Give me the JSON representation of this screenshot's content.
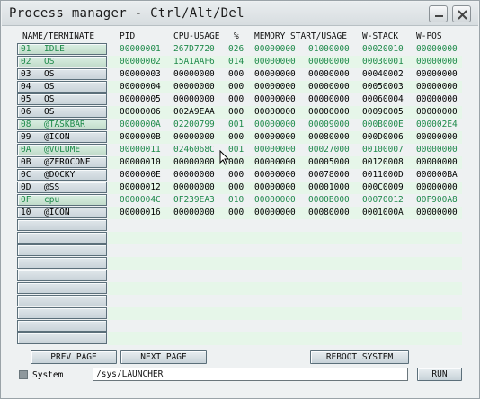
{
  "window": {
    "title": "Process manager - Ctrl/Alt/Del"
  },
  "columns": {
    "name": "NAME/TERMINATE",
    "pid": "PID",
    "cpu": "CPU-USAGE",
    "pct": "%",
    "mem": "MEMORY START/USAGE",
    "wstack": "W-STACK",
    "wpos": "W-POS"
  },
  "processes": [
    {
      "idx": "01",
      "name": "IDLE",
      "pid": "00000001",
      "cpu": "267D7720",
      "pct": "026",
      "mem_start": "00000000",
      "mem_usage": "01000000",
      "wstack": "00020010",
      "wpos": "00000000",
      "highlight": true
    },
    {
      "idx": "02",
      "name": "OS",
      "pid": "00000002",
      "cpu": "15A1AAF6",
      "pct": "014",
      "mem_start": "00000000",
      "mem_usage": "00000000",
      "wstack": "00030001",
      "wpos": "00000000",
      "highlight": true
    },
    {
      "idx": "03",
      "name": "OS",
      "pid": "00000003",
      "cpu": "00000000",
      "pct": "000",
      "mem_start": "00000000",
      "mem_usage": "00000000",
      "wstack": "00040002",
      "wpos": "00000000",
      "highlight": false
    },
    {
      "idx": "04",
      "name": "OS",
      "pid": "00000004",
      "cpu": "00000000",
      "pct": "000",
      "mem_start": "00000000",
      "mem_usage": "00000000",
      "wstack": "00050003",
      "wpos": "00000000",
      "highlight": false
    },
    {
      "idx": "05",
      "name": "OS",
      "pid": "00000005",
      "cpu": "00000000",
      "pct": "000",
      "mem_start": "00000000",
      "mem_usage": "00000000",
      "wstack": "00060004",
      "wpos": "00000000",
      "highlight": false
    },
    {
      "idx": "06",
      "name": "OS",
      "pid": "00000006",
      "cpu": "002A9EAA",
      "pct": "000",
      "mem_start": "00000000",
      "mem_usage": "00000000",
      "wstack": "00090005",
      "wpos": "00000000",
      "highlight": false
    },
    {
      "idx": "08",
      "name": "@TASKBAR",
      "pid": "0000000A",
      "cpu": "02200799",
      "pct": "001",
      "mem_start": "00000000",
      "mem_usage": "00009000",
      "wstack": "000B000E",
      "wpos": "000002E4",
      "highlight": true
    },
    {
      "idx": "09",
      "name": "@ICON",
      "pid": "0000000B",
      "cpu": "00000000",
      "pct": "000",
      "mem_start": "00000000",
      "mem_usage": "00080000",
      "wstack": "000D0006",
      "wpos": "00000000",
      "highlight": false
    },
    {
      "idx": "0A",
      "name": "@VOLUME",
      "pid": "00000011",
      "cpu": "0246068C",
      "pct": "001",
      "mem_start": "00000000",
      "mem_usage": "00027000",
      "wstack": "00100007",
      "wpos": "00000000",
      "highlight": true
    },
    {
      "idx": "0B",
      "name": "@ZEROCONF",
      "pid": "00000010",
      "cpu": "00000000",
      "pct": "000",
      "mem_start": "00000000",
      "mem_usage": "00005000",
      "wstack": "00120008",
      "wpos": "00000000",
      "highlight": false
    },
    {
      "idx": "0C",
      "name": "@DOCKY",
      "pid": "0000000E",
      "cpu": "00000000",
      "pct": "000",
      "mem_start": "00000000",
      "mem_usage": "00078000",
      "wstack": "0011000D",
      "wpos": "000000BA",
      "highlight": false
    },
    {
      "idx": "0D",
      "name": "@SS",
      "pid": "00000012",
      "cpu": "00000000",
      "pct": "000",
      "mem_start": "00000000",
      "mem_usage": "00001000",
      "wstack": "000C0009",
      "wpos": "00000000",
      "highlight": false
    },
    {
      "idx": "0F",
      "name": "cpu",
      "pid": "0000004C",
      "cpu": "0F239EA3",
      "pct": "010",
      "mem_start": "00000000",
      "mem_usage": "0000B000",
      "wstack": "00070012",
      "wpos": "00F900A8",
      "highlight": true
    },
    {
      "idx": "10",
      "name": "@ICON",
      "pid": "00000016",
      "cpu": "00000000",
      "pct": "000",
      "mem_start": "00000000",
      "mem_usage": "00080000",
      "wstack": "0001000A",
      "wpos": "00000000",
      "highlight": false
    }
  ],
  "empty_slots": 10,
  "buttons": {
    "prev": "PREV PAGE",
    "next": "NEXT PAGE",
    "reboot": "REBOOT SYSTEM",
    "run": "RUN"
  },
  "system_checkbox": {
    "label": "System",
    "checked": false
  },
  "command": {
    "value": "/sys/LAUNCHER"
  },
  "colors": {
    "highlight_text": "#1e8a4a",
    "row_stripe": "#e6f6e9"
  },
  "icons": {
    "minimize": "minimize-icon",
    "close": "close-icon",
    "cursor": "mouse-cursor-icon"
  }
}
